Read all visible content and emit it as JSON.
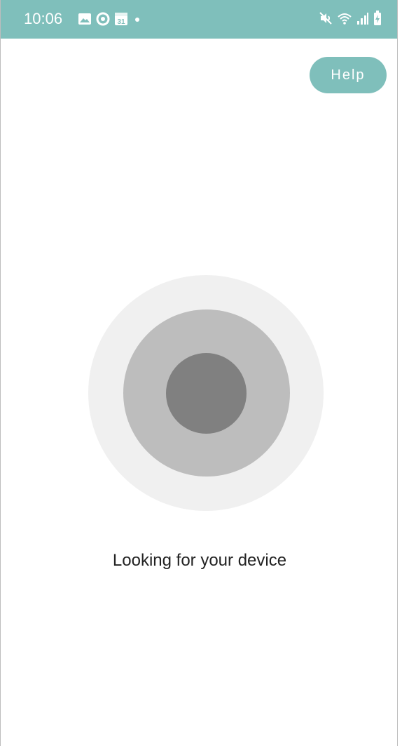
{
  "status_bar": {
    "time": "10:06",
    "left_icons": [
      "gallery-icon",
      "ring-notification-icon",
      "calendar-icon",
      "dot-icon"
    ],
    "calendar_day": "31",
    "right_icons": [
      "mute-vibrate-icon",
      "wifi-icon",
      "signal-icon",
      "battery-charging-icon"
    ],
    "background_color": "#7fbfbb"
  },
  "header": {
    "help_label": "Help"
  },
  "scanner": {
    "outer_color": "#f0f0f0",
    "middle_color": "#bdbdbd",
    "inner_color": "#808080"
  },
  "main": {
    "status_message": "Looking for your device"
  },
  "colors": {
    "accent": "#7fbfbb",
    "text": "#222222"
  }
}
